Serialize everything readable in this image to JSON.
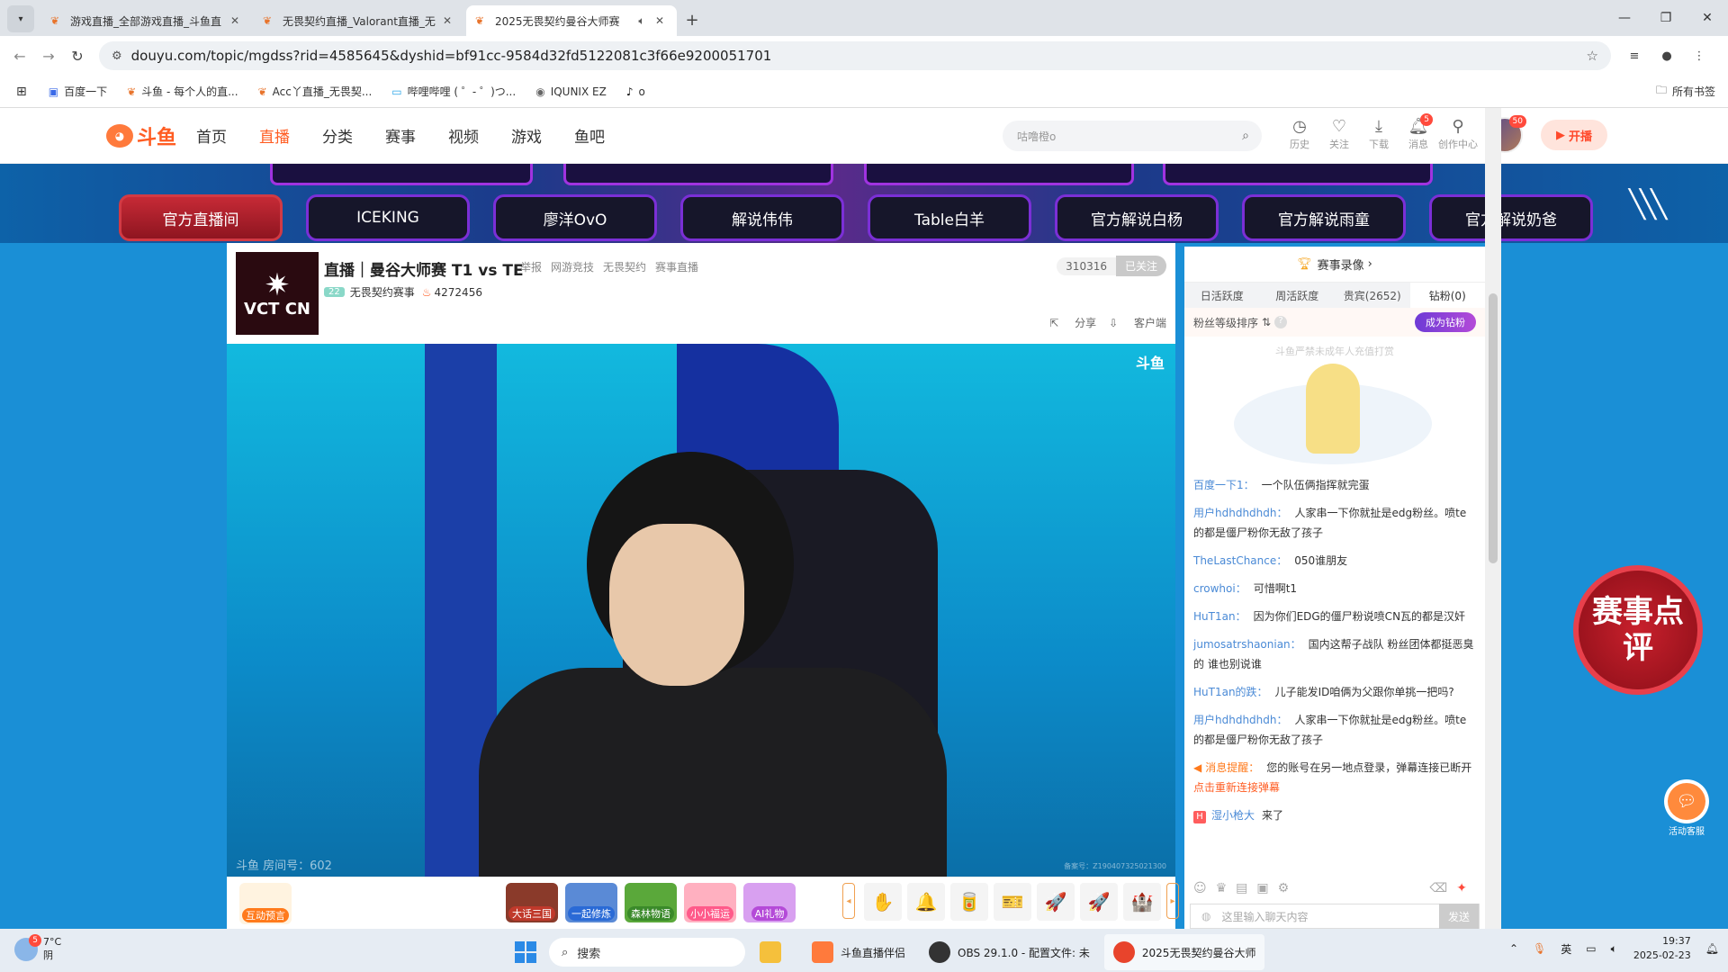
{
  "browser": {
    "tabs": [
      {
        "title": "游戏直播_全部游戏直播_斗鱼直",
        "active": false
      },
      {
        "title": "无畏契约直播_Valorant直播_无",
        "active": false
      },
      {
        "title": "2025无畏契约曼谷大师赛",
        "active": true
      }
    ],
    "url": "douyu.com/topic/mgdss?rid=4585645&dyshid=bf91cc-9584d32fd5122081c3f66e9200051701",
    "bookmarks": [
      "百度一下",
      "斗鱼 - 每个人的直...",
      "Acc丫直播_无畏契...",
      "哔哩哔哩 ( ゜- ゜)つ...",
      "IQUNIX EZ",
      "o"
    ],
    "all_bookmarks": "所有书签"
  },
  "site": {
    "logo_text": "斗鱼",
    "nav": [
      "首页",
      "直播",
      "分类",
      "赛事",
      "视频",
      "游戏",
      "鱼吧"
    ],
    "nav_active": "直播",
    "search_placeholder": "咕噜橙o",
    "header_icons": [
      {
        "label": "历史",
        "icon": "history-icon",
        "badge": ""
      },
      {
        "label": "关注",
        "icon": "heart-icon",
        "badge": ""
      },
      {
        "label": "下载",
        "icon": "download-icon",
        "badge": ""
      },
      {
        "label": "消息",
        "icon": "bell-icon",
        "badge": "5"
      },
      {
        "label": "创作中心",
        "icon": "bulb-icon",
        "badge": ""
      }
    ],
    "avatar_badge": "50",
    "kaibo": "开播"
  },
  "channels": [
    "官方直播间",
    "ICEKING",
    "廖洋OvO",
    "解说伟伟",
    "Table白羊",
    "官方解说白杨",
    "官方解说雨童",
    "官方解说奶爸"
  ],
  "room": {
    "logo_text": "VCT CN",
    "title": "直播｜曼谷大师赛 T1 vs TE",
    "report": "举报",
    "breadcrumb": [
      "网游竞技",
      "无畏契约",
      "赛事直播"
    ],
    "level": "22",
    "anchor": "无畏契约赛事",
    "hot": "4272456",
    "fans": "310316",
    "follow": "已关注",
    "share": "分享",
    "client": "客户端",
    "video_overlay": "斗鱼 房间号：602",
    "watermark": "斗鱼",
    "cert": "备案号：Z190407325021300"
  },
  "gift_bar": {
    "interact": "互动预言",
    "games": [
      {
        "label": "大话三国",
        "color": "#8a3a2a"
      },
      {
        "label": "一起修炼",
        "color": "#5a8ad6"
      },
      {
        "label": "森林物语",
        "color": "#5aa83a"
      },
      {
        "label": "小小福运",
        "color": "#ff6a8a"
      },
      {
        "label": "AI礼物",
        "color": "#b44ad8"
      }
    ],
    "items": [
      "✋",
      "🔔",
      "🥫",
      "🎫",
      "🚀",
      "🚀",
      "🏰"
    ]
  },
  "side": {
    "record": "赛事录像",
    "tabs": [
      "日活跃度",
      "周活跃度",
      "贵宾(2652)",
      "钻粉(0)"
    ],
    "active_tab": "钻粉(0)",
    "fan_rank": "粉丝等级排序",
    "become_diamond": "成为钻粉",
    "warning": "斗鱼严禁未成年人充值打赏",
    "messages": [
      {
        "nick": "百度一下1：",
        "text": "一个队伍俩指挥就完蛋"
      },
      {
        "nick": "用户hdhdhdhdh：",
        "text": "人家串一下你就扯是edg粉丝。喷te的都是僵尸粉你无敌了孩子"
      },
      {
        "nick": "TheLastChance：",
        "text": "050谁朋友"
      },
      {
        "nick": "crowhoi：",
        "text": "可惜啊t1"
      },
      {
        "nick": "HuT1an：",
        "text": "因为你们EDG的僵尸粉说喷CN瓦的都是汉奸"
      },
      {
        "nick": "jumosatrshaonian：",
        "text": "国内这帮子战队 粉丝团体都挺恶臭的 谁也别说谁"
      },
      {
        "nick": "HuT1an的跌：",
        "text": "儿子能发ID咱俩为父跟你单挑一把吗?"
      },
      {
        "nick": "用户hdhdhdhdh：",
        "text": "人家串一下你就扯是edg粉丝。喷te的都是僵尸粉你无敌了孩子"
      }
    ],
    "system_msg": {
      "nick": "消息提醒：",
      "text": "您的账号在另一地点登录，弹幕连接已断开",
      "action": "点击重新连接弹幕"
    },
    "join_msg": {
      "nick": "湿小枪大",
      "text": "来了"
    },
    "input_placeholder": "这里输入聊天内容",
    "send": "发送"
  },
  "floating": {
    "review": "赛事点评",
    "service": "活动客服"
  },
  "taskbar": {
    "weather_temp": "7°C",
    "weather_desc": "阴",
    "weather_badge": "5",
    "search": "搜索",
    "apps": [
      {
        "label": "斗鱼直播伴侣",
        "color": "#ff7a3c",
        "active": false
      },
      {
        "label": "OBS 29.1.0 - 配置文件: 未",
        "color": "#333",
        "active": false
      },
      {
        "label": "2025无畏契约曼谷大师",
        "color": "#e8442c",
        "active": true
      }
    ],
    "ime": "英",
    "time": "19:37",
    "date": "2025-02-23"
  }
}
